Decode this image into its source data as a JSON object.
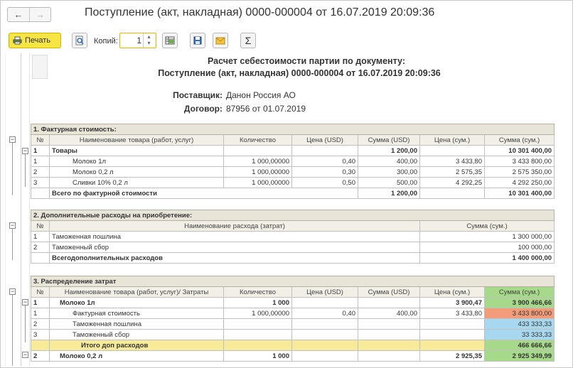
{
  "window": {
    "title": "Поступление (акт, накладная) 0000-000004 от 16.07.2019 20:09:36",
    "nav_back": "←",
    "nav_forward": "→"
  },
  "toolbar": {
    "print_label": "Печать",
    "copies_label": "Копий:",
    "copies_value": "1",
    "sum_icon": "Σ"
  },
  "doc": {
    "heading1": "Расчет себестоимости партии по документу:",
    "heading2": "Поступление (акт, накладная) 0000-000004 от 16.07.2019 20:09:36",
    "supplier_label": "Поставщик:",
    "supplier_value": "Данон Россия АО",
    "contract_label": "Договор:",
    "contract_value": "87956 от 01.07.2019"
  },
  "sec1": {
    "title": "1. Фактурная стоимость:",
    "headers": [
      "№",
      "Наименование товара (работ, услуг)",
      "Количество",
      "Цена (USD)",
      "Сумма (USD)",
      "Цена (сум.)",
      "Сумма (сум.)"
    ],
    "group": {
      "num": "1",
      "name": "Товары",
      "sum_usd": "1 200,00",
      "sum_sum": "10 301 400,00"
    },
    "rows": [
      {
        "num": "1",
        "name": "Молоко 1л",
        "qty": "1 000,00000",
        "price_usd": "0,40",
        "sum_usd": "400,00",
        "price_sum": "3 433,80",
        "sum_sum": "3 433 800,00"
      },
      {
        "num": "2",
        "name": "Молоко 0,2 л",
        "qty": "1 000,00000",
        "price_usd": "0,30",
        "sum_usd": "300,00",
        "price_sum": "2 575,35",
        "sum_sum": "2 575 350,00"
      },
      {
        "num": "3",
        "name": "Сливки 10% 0,2 л",
        "qty": "1 000,00000",
        "price_usd": "0,50",
        "sum_usd": "500,00",
        "price_sum": "4 292,25",
        "sum_sum": "4 292 250,00"
      }
    ],
    "total": {
      "label": "Всего по фактурной стоимости",
      "sum_usd": "1 200,00",
      "sum_sum": "10 301 400,00"
    }
  },
  "sec2": {
    "title": "2. Дополнительные расходы на приобретение:",
    "headers": [
      "№",
      "Наименование расхода (затрат)",
      "Сумма (сум.)"
    ],
    "rows": [
      {
        "num": "1",
        "name": "Таможенная пошлина",
        "sum": "1 300 000,00"
      },
      {
        "num": "2",
        "name": "Таможенный сбор",
        "sum": "100 000,00"
      }
    ],
    "total": {
      "label": "Всегодополнительных расходов",
      "sum": "1 400 000,00"
    }
  },
  "sec3": {
    "title": "3. Распределение затрат",
    "headers": [
      "№",
      "Наименование товара (работ, услуг)/ Затраты",
      "Количество",
      "Цена (USD)",
      "Сумма (USD)",
      "Цена (сум.)",
      "Сумма (сум.)"
    ],
    "item1": {
      "num": "1",
      "name": "Молоко 1л",
      "qty": "1 000",
      "price_sum": "3 900,47",
      "sum_sum": "3 900 466,66"
    },
    "item1_rows": [
      {
        "num": "1",
        "name": "Фактурная стоимость",
        "qty": "1 000,00000",
        "price_usd": "0,40",
        "sum_usd": "400,00",
        "price_sum": "3 433,80",
        "sum_sum": "3 433 800,00"
      },
      {
        "num": "2",
        "name": "Таможенная пошлина",
        "sum_sum": "433 333,33"
      },
      {
        "num": "3",
        "name": "Таможенный сбор",
        "sum_sum": "33 333,33"
      }
    ],
    "item1_total": {
      "label": "Итого доп расходов",
      "sum_sum": "466 666,66"
    },
    "item2": {
      "num": "2",
      "name": "Молоко 0,2 л",
      "qty": "1 000",
      "price_sum": "2 925,35",
      "sum_sum": "2 925 349,99"
    }
  }
}
